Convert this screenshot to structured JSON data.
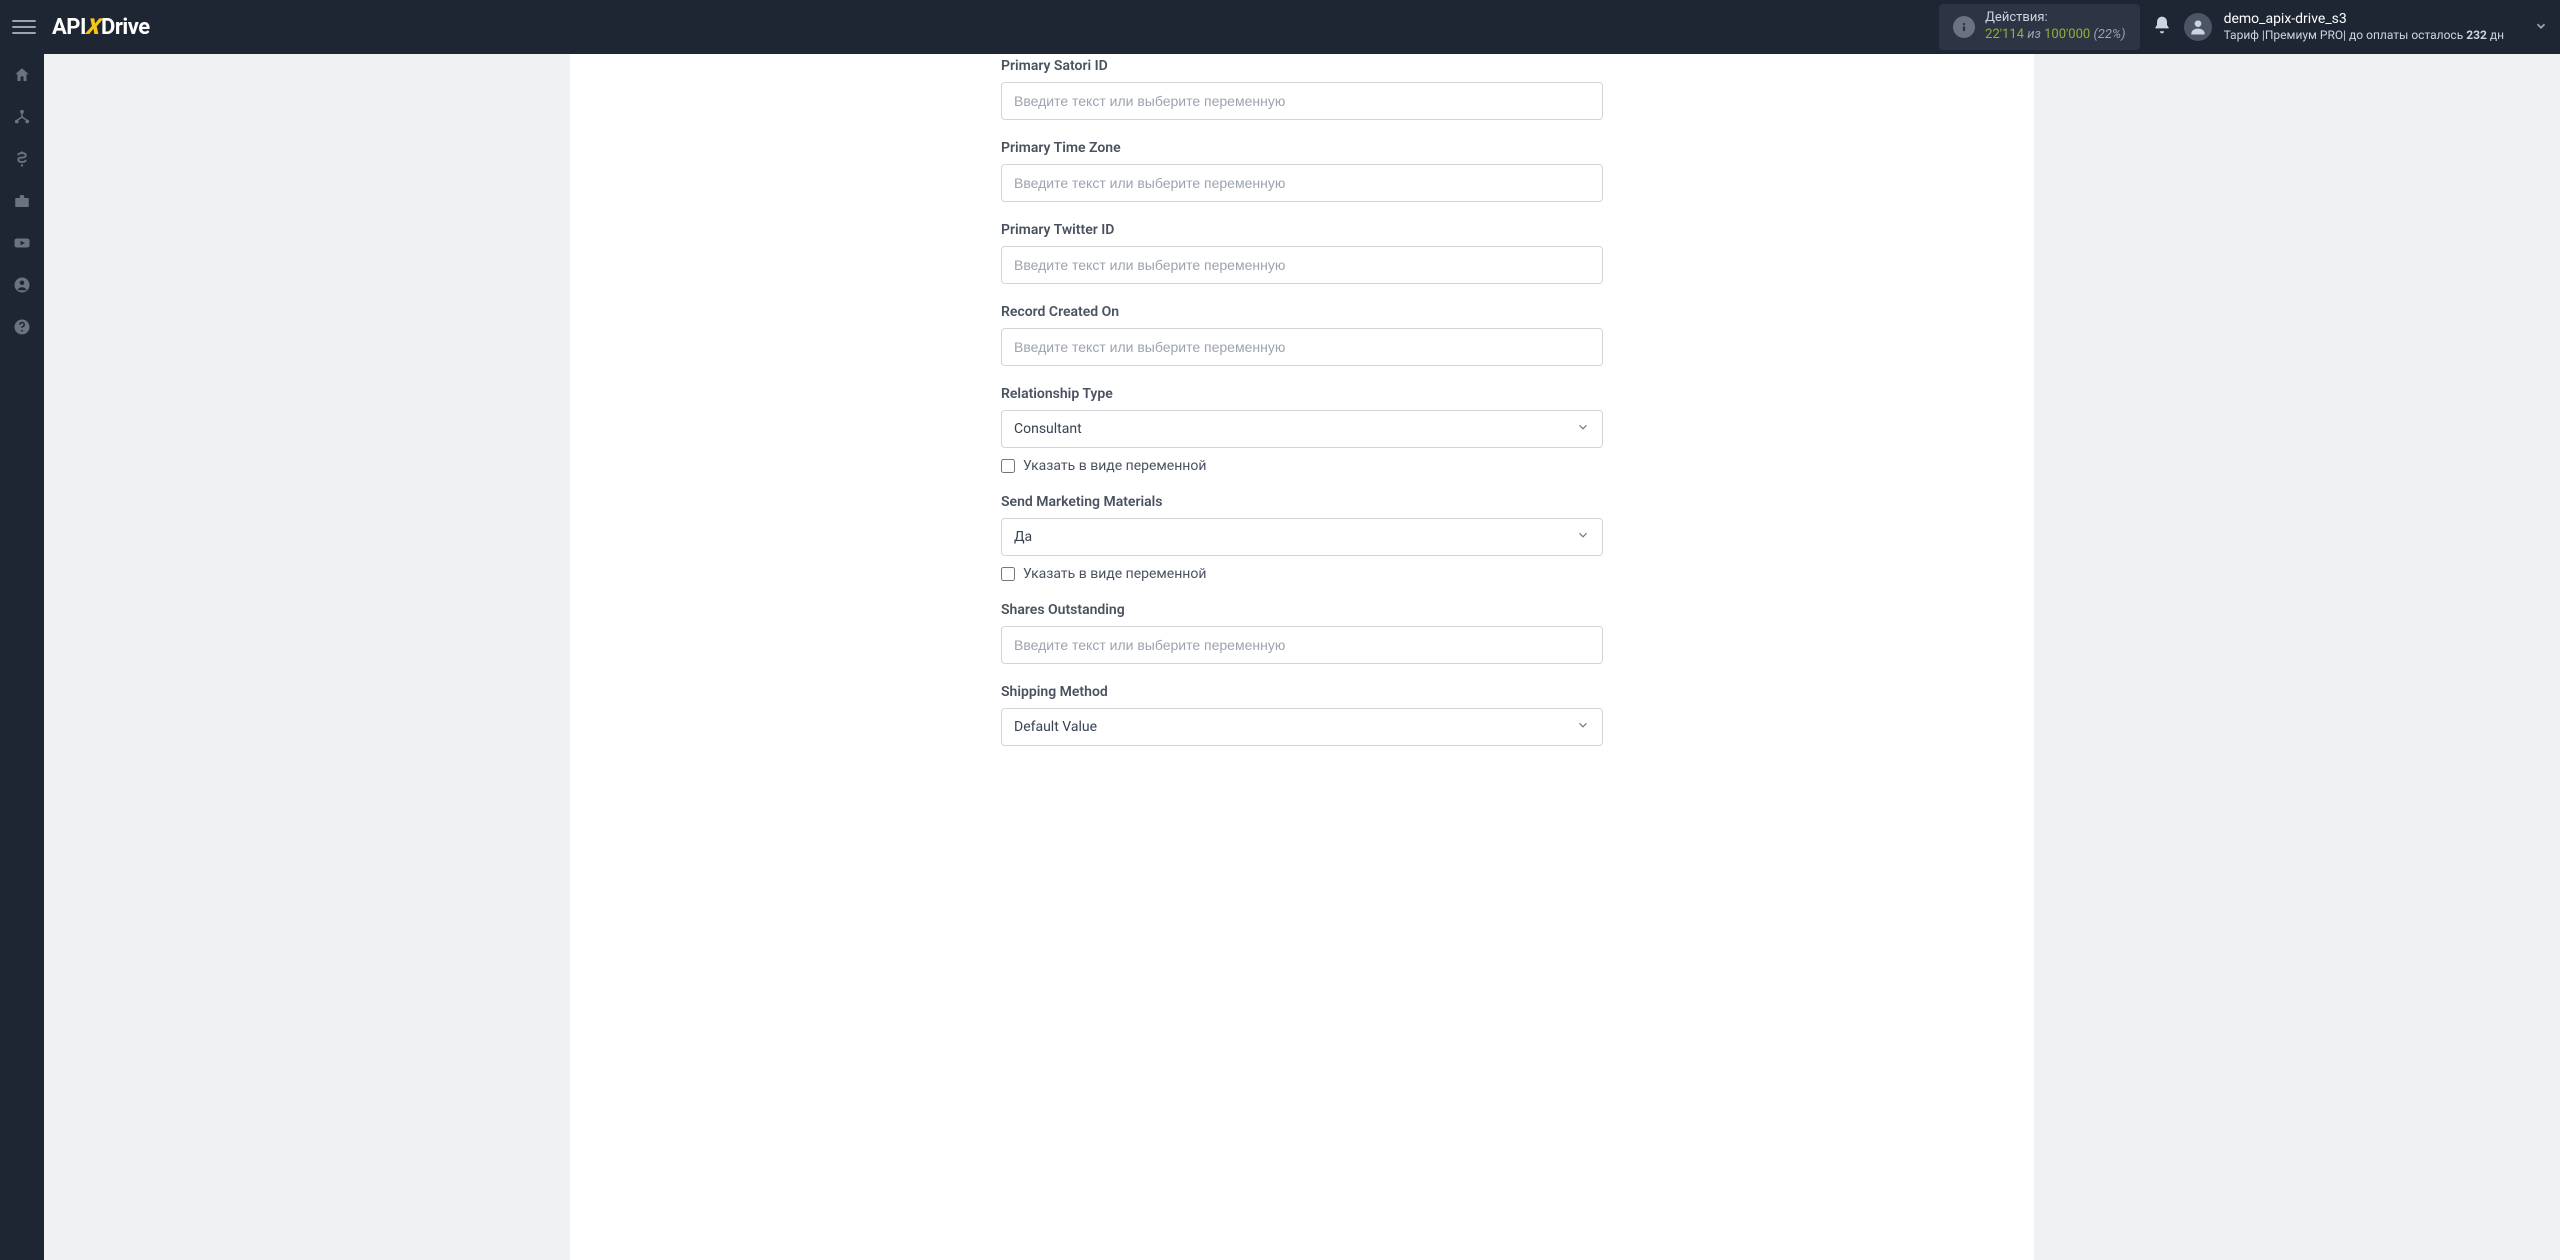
{
  "header": {
    "logo": {
      "prefix": "API",
      "x": "X",
      "suffix": "Drive"
    },
    "actions": {
      "label": "Действия:",
      "used": "22'114",
      "of": "из",
      "total": "100'000",
      "percent": "(22%)"
    },
    "user": {
      "name": "demo_apix-drive_s3",
      "tariff_prefix": "Тариф |",
      "tariff_name": "Премиум PRO",
      "payment_prefix": "| до оплаты осталось ",
      "days": "232",
      "days_suffix": " дн"
    }
  },
  "fields": {
    "satori_id": {
      "label": "Primary Satori ID",
      "placeholder": "Введите текст или выберите переменную"
    },
    "time_zone": {
      "label": "Primary Time Zone",
      "placeholder": "Введите текст или выберите переменную"
    },
    "twitter_id": {
      "label": "Primary Twitter ID",
      "placeholder": "Введите текст или выберите переменную"
    },
    "record_created": {
      "label": "Record Created On",
      "placeholder": "Введите текст или выберите переменную"
    },
    "relationship_type": {
      "label": "Relationship Type",
      "value": "Consultant",
      "variable_label": "Указать в виде переменной"
    },
    "send_marketing": {
      "label": "Send Marketing Materials",
      "value": "Да",
      "variable_label": "Указать в виде переменной"
    },
    "shares_outstanding": {
      "label": "Shares Outstanding",
      "placeholder": "Введите текст или выберите переменную"
    },
    "shipping_method": {
      "label": "Shipping Method",
      "value": "Default Value"
    }
  }
}
